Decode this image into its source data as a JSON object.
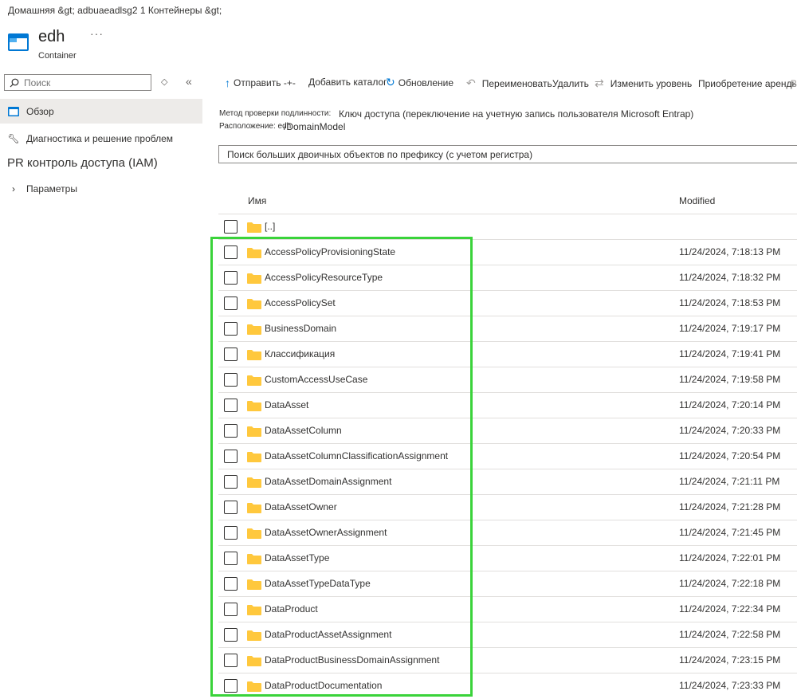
{
  "breadcrumb": "Домашняя &gt; adbuaeadlsg2 1 Контейнеры &gt;",
  "resource": {
    "title": "edh",
    "subtitle": "Container",
    "more": "···"
  },
  "nav": {
    "search_placeholder": "Поиск",
    "overview": "Обзор",
    "diagnose": "Диагностика и решение проблем",
    "iam": "PR контроль доступа (IAM)",
    "settings": "Параметры"
  },
  "toolbar": {
    "upload": "Отправить -+-",
    "add_dir": "Добавить каталог",
    "refresh": "Обновление",
    "rename": "Переименовать",
    "delete": "Удалить",
    "change_tier": "Изменить уровень",
    "lease": "Приобретение аренды",
    "overflow": "В"
  },
  "info": {
    "auth_label": "Метод проверки подлинности:",
    "auth_value": "Ключ доступа (переключение на учетную запись пользователя Microsoft Entrap)",
    "location_label": "Расположение: edh",
    "location_value": "/DomainModel"
  },
  "blob_search_placeholder": "Поиск больших двоичных объектов по префиксу (с учетом регистра)",
  "table": {
    "col_name": "Имя",
    "col_modified": "Modified",
    "parent": "[..]",
    "rows": [
      {
        "name": "AccessPolicyProvisioningState",
        "modified": "11/24/2024, 7:18:13 PM"
      },
      {
        "name": "AccessPolicyResourceType",
        "modified": "11/24/2024, 7:18:32 PM"
      },
      {
        "name": "AccessPolicySet",
        "modified": "11/24/2024, 7:18:53 PM"
      },
      {
        "name": "BusinessDomain",
        "modified": "11/24/2024, 7:19:17 PM"
      },
      {
        "name": "Классификация",
        "modified": "11/24/2024, 7:19:41 PM"
      },
      {
        "name": "CustomAccessUseCase",
        "modified": "11/24/2024, 7:19:58 PM"
      },
      {
        "name": "DataAsset",
        "modified": "11/24/2024, 7:20:14 PM"
      },
      {
        "name": "DataAssetColumn",
        "modified": "11/24/2024, 7:20:33 PM"
      },
      {
        "name": "DataAssetColumnClassificationAssignment",
        "modified": "11/24/2024, 7:20:54 PM"
      },
      {
        "name": "DataAssetDomainAssignment",
        "modified": "11/24/2024, 7:21:11 PM"
      },
      {
        "name": "DataAssetOwner",
        "modified": "11/24/2024, 7:21:28 PM"
      },
      {
        "name": "DataAssetOwnerAssignment",
        "modified": "11/24/2024, 7:21:45 PM"
      },
      {
        "name": "DataAssetType",
        "modified": "11/24/2024, 7:22:01 PM"
      },
      {
        "name": "DataAssetTypeDataType",
        "modified": "11/24/2024, 7:22:18 PM"
      },
      {
        "name": "DataProduct",
        "modified": "11/24/2024, 7:22:34 PM"
      },
      {
        "name": "DataProductAssetAssignment",
        "modified": "11/24/2024, 7:22:58 PM"
      },
      {
        "name": "DataProductBusinessDomainAssignment",
        "modified": "11/24/2024, 7:23:15 PM"
      },
      {
        "name": "DataProductDocumentation",
        "modified": "11/24/2024, 7:23:33 PM"
      }
    ]
  },
  "colors": {
    "accent": "#0078d4",
    "folder": "#ffc83d",
    "highlight": "#3ad33a",
    "nav_selected": "#edebe9"
  }
}
